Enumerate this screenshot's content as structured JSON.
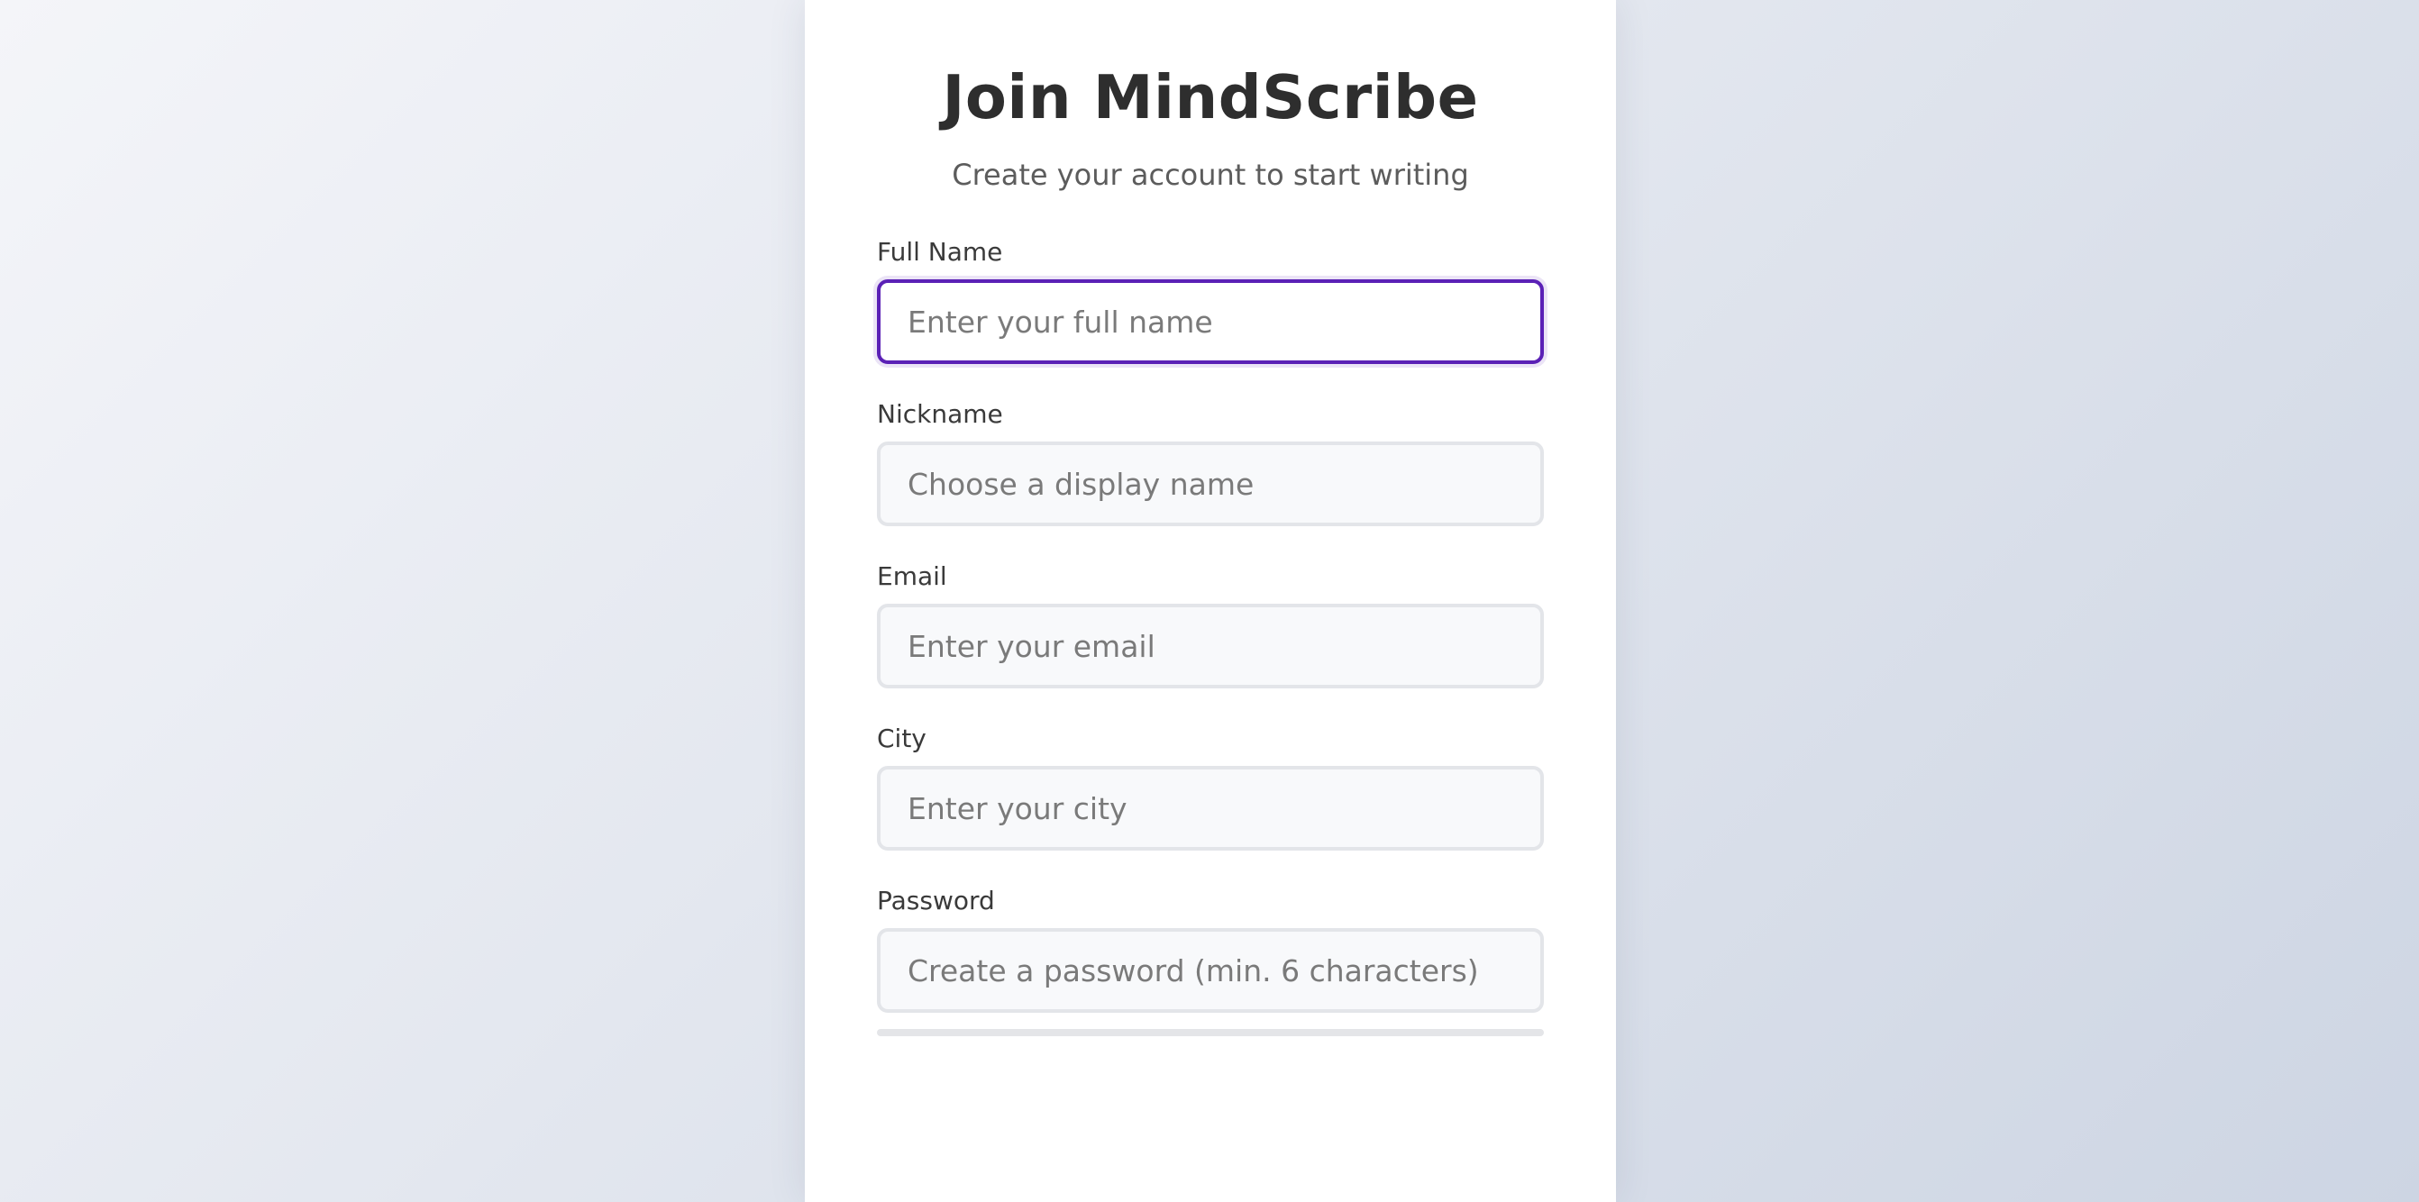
{
  "signup": {
    "title": "Join MindScribe",
    "subtitle": "Create your account to start writing",
    "fields": [
      {
        "label": "Full Name",
        "placeholder": "Enter your full name",
        "value": "",
        "focused": true
      },
      {
        "label": "Nickname",
        "placeholder": "Choose a display name",
        "value": "",
        "focused": false
      },
      {
        "label": "Email",
        "placeholder": "Enter your email",
        "value": "",
        "focused": false
      },
      {
        "label": "City",
        "placeholder": "Enter your city",
        "value": "",
        "focused": false
      },
      {
        "label": "Password",
        "placeholder": "Create a password (min. 6 characters)",
        "value": "",
        "focused": false
      }
    ],
    "password_strength": 0
  },
  "colors": {
    "accent": "#5b21b6",
    "input_border": "#e3e5e9",
    "input_bg": "#f8f9fb",
    "title_text": "#2e2e2e"
  }
}
